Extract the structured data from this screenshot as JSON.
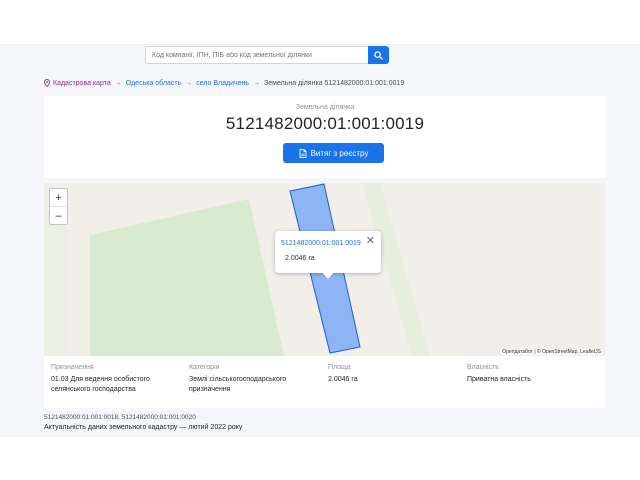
{
  "search": {
    "placeholder": "Код компанії, ІПН, ПІБ або код земельної ділянки"
  },
  "breadcrumb": {
    "items": [
      {
        "label": "Кадастрова карта"
      },
      {
        "label": "Одеська область"
      },
      {
        "label": "село Владичень"
      }
    ],
    "separator": "→",
    "current": "Земельна ділянка 5121482000:01:001:0019"
  },
  "header": {
    "subtitle": "Земельна ділянка",
    "title": "5121482000:01:001:0019",
    "extract_button": "Витяг з реєстру"
  },
  "map": {
    "zoom_in": "+",
    "zoom_out": "–",
    "popup": {
      "title": "5121482000:01:001:0019",
      "area": "2.0046 га",
      "close": "✕"
    },
    "attribution": "Openдатабот | © OpenStreetMap, LeafletJS"
  },
  "details": [
    {
      "label": "Призначення",
      "value": "01.03 Для ведення особистого селянського господарства"
    },
    {
      "label": "Категорія",
      "value": "Землі сільськогосподарського призначення"
    },
    {
      "label": "Площа",
      "value": "2.0046 га"
    },
    {
      "label": "Власність",
      "value": "Приватна власність"
    }
  ],
  "footer": {
    "related": "5121482000:01:001:0018, 5121482000:01:001:0020",
    "updated": "Актуальність даних земельного кадастру — лютий 2022 року"
  },
  "colors": {
    "accent": "#1a73e8",
    "parcel_fill": "#7ea9f5",
    "parcel_stroke": "#1a5fd6",
    "map_green": "#d8ead0"
  }
}
